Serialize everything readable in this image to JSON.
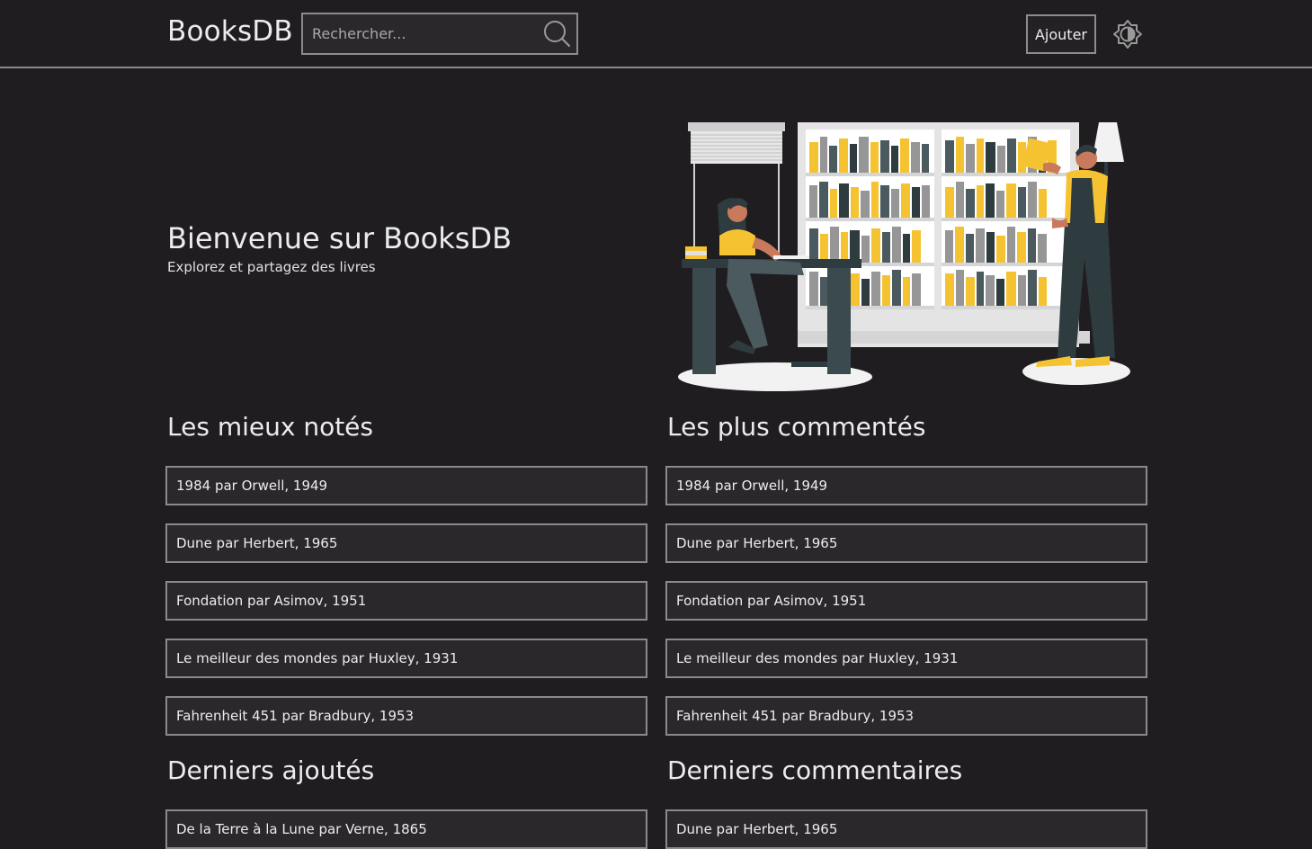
{
  "header": {
    "logo": "BooksDB",
    "search_placeholder": "Rechercher...",
    "add_label": "Ajouter"
  },
  "hero": {
    "title": "Bienvenue sur BooksDB",
    "subtitle": "Explorez et partagez des livres"
  },
  "colors": {
    "background": "#1f1d20",
    "accent_yellow": "#f5c332",
    "border": "#8a8a8a"
  },
  "sections": {
    "top_rated": {
      "title": "Les mieux notés",
      "items": [
        "1984 par Orwell, 1949",
        "Dune par Herbert, 1965",
        "Fondation par Asimov, 1951",
        "Le meilleur des mondes par Huxley, 1931",
        "Fahrenheit 451 par Bradbury, 1953"
      ]
    },
    "most_commented": {
      "title": "Les plus commentés",
      "items": [
        "1984 par Orwell, 1949",
        "Dune par Herbert, 1965",
        "Fondation par Asimov, 1951",
        "Le meilleur des mondes par Huxley, 1931",
        "Fahrenheit 451 par Bradbury, 1953"
      ]
    },
    "latest_added": {
      "title": "Derniers ajoutés",
      "items": [
        "De la Terre à la Lune par Verne, 1865"
      ]
    },
    "latest_comments": {
      "title": "Derniers commentaires",
      "items": [
        "Dune par Herbert, 1965"
      ]
    }
  }
}
